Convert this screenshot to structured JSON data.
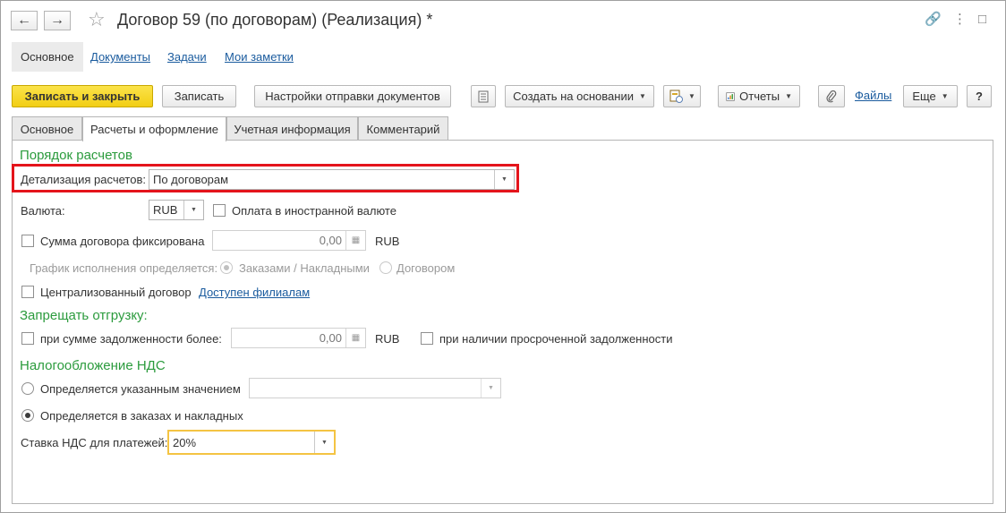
{
  "window": {
    "title": "Договор 59 (по договорам) (Реализация) *",
    "back_icon": "←",
    "forward_icon": "→",
    "favorite_icon": "☆",
    "link_icon": "🔗",
    "menu_icon": "⋮",
    "maximize_icon": "□",
    "close_icon": "✕"
  },
  "page_tabs": [
    "Основное",
    "Документы",
    "Задачи",
    "Мои заметки"
  ],
  "toolbar": {
    "save_close": "Записать и закрыть",
    "save": "Записать",
    "send_settings": "Настройки отправки документов",
    "create_based": "Создать на основании",
    "reports": "Отчеты",
    "files": "Файлы",
    "more": "Еще",
    "help": "?"
  },
  "form_tabs": [
    "Основное",
    "Расчеты и оформление",
    "Учетная информация",
    "Комментарий"
  ],
  "payment_order": {
    "section": "Порядок расчетов",
    "detail_label": "Детализация расчетов:",
    "detail_value": "По договорам",
    "currency_label": "Валюта:",
    "currency_value": "RUB",
    "foreign_payment_label": "Оплата в иностранной валюте",
    "fixed_sum_label": "Сумма договора фиксирована",
    "fixed_sum_value": "0,00",
    "fixed_sum_currency": "RUB",
    "schedule_label": "График исполнения определяется:",
    "schedule_option1": "Заказами / Накладными",
    "schedule_option2": "Договором",
    "centralized_label": "Централизованный договор",
    "branches_link": "Доступен филиалам"
  },
  "shipment_ban": {
    "section": "Запрещать отгрузку:",
    "debt_label": "при сумме задолженности более:",
    "debt_value": "0,00",
    "debt_currency": "RUB",
    "overdue_label": "при наличии просроченной задолженности"
  },
  "vat": {
    "section": "Налогообложение НДС",
    "option1": "Определяется указанным значением",
    "option2": "Определяется в заказах и накладных",
    "rate_label": "Ставка НДС для платежей:",
    "rate_value": "20%"
  },
  "colors": {
    "accent_yellow": "#f2ce14",
    "section_green": "#2b9b3d",
    "link_blue": "#1a5b9e",
    "highlight_red": "#e4141b",
    "focus_yellow": "#f4c443"
  }
}
